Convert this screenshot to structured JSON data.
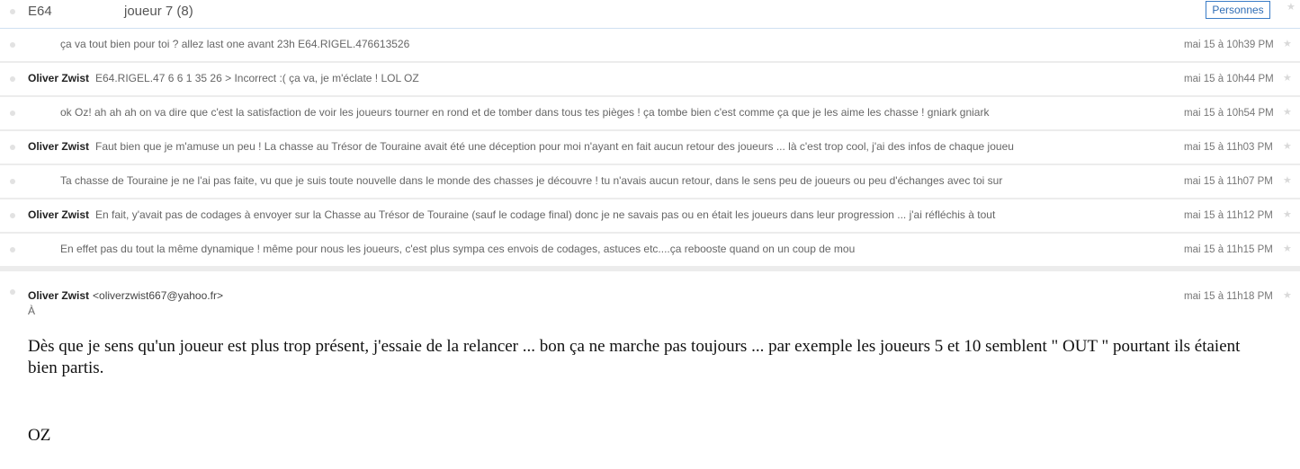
{
  "header": {
    "subject_id": "E64",
    "subject_title": "joueur 7 (8)",
    "people_button": "Personnes"
  },
  "messages": [
    {
      "sender": "",
      "snippet": "ça va tout bien pour toi ? allez last one avant 23h E64.RIGEL.476613526",
      "date": "mai 15 à 10h39 PM"
    },
    {
      "sender": "Oliver Zwist",
      "snippet": "E64.RIGEL.47 6 6 1 35 26 > Incorrect :( ça va, je m'éclate ! LOL OZ",
      "date": "mai 15 à 10h44 PM"
    },
    {
      "sender": "",
      "snippet": "ok Oz! ah ah ah on va dire que c'est la satisfaction de voir les joueurs tourner en rond et de tomber dans tous tes pièges ! ça tombe bien c'est comme ça que je les aime les chasse ! gniark gniark",
      "date": "mai 15 à 10h54 PM"
    },
    {
      "sender": "Oliver Zwist",
      "snippet": "Faut bien que je m'amuse un peu ! La chasse au Trésor de Touraine avait été une déception pour moi n'ayant en fait aucun retour des joueurs ... là c'est trop cool, j'ai des infos de chaque joueu",
      "date": "mai 15 à 11h03 PM"
    },
    {
      "sender": "",
      "snippet": "Ta chasse de Touraine je ne l'ai pas faite, vu que je suis toute nouvelle dans le monde des chasses je découvre ! tu n'avais aucun retour, dans le sens peu de joueurs ou peu d'échanges avec toi sur",
      "date": "mai 15 à 11h07 PM"
    },
    {
      "sender": "Oliver Zwist",
      "snippet": "En fait, y'avait pas de codages à envoyer sur la Chasse au Trésor de Touraine (sauf le codage final) donc je ne savais pas ou en était les joueurs dans leur progression ... j'ai réfléchis à tout",
      "date": "mai 15 à 11h12 PM"
    },
    {
      "sender": "",
      "snippet": "En effet pas du tout la même dynamique ! même pour nous les joueurs, c'est plus sympa ces envois de codages, astuces etc....ça rebooste quand on un coup de mou",
      "date": "mai 15 à 11h15 PM"
    }
  ],
  "open_message": {
    "sender": "Oliver Zwist",
    "email": "<oliverzwist667@yahoo.fr>",
    "to_label": "À",
    "date": "mai 15 à 11h18 PM",
    "body": "Dès que je sens qu'un joueur est plus trop présent, j'essaie de la relancer ... bon ça ne marche pas toujours ... par exemple les joueurs 5 et 10 semblent \" OUT \" pourtant ils étaient bien partis.",
    "signature": "OZ"
  },
  "icons": {
    "unread": "dot-icon",
    "favorite": "star-icon"
  },
  "colors": {
    "accent": "#2f6db5",
    "divider": "#ececec"
  }
}
